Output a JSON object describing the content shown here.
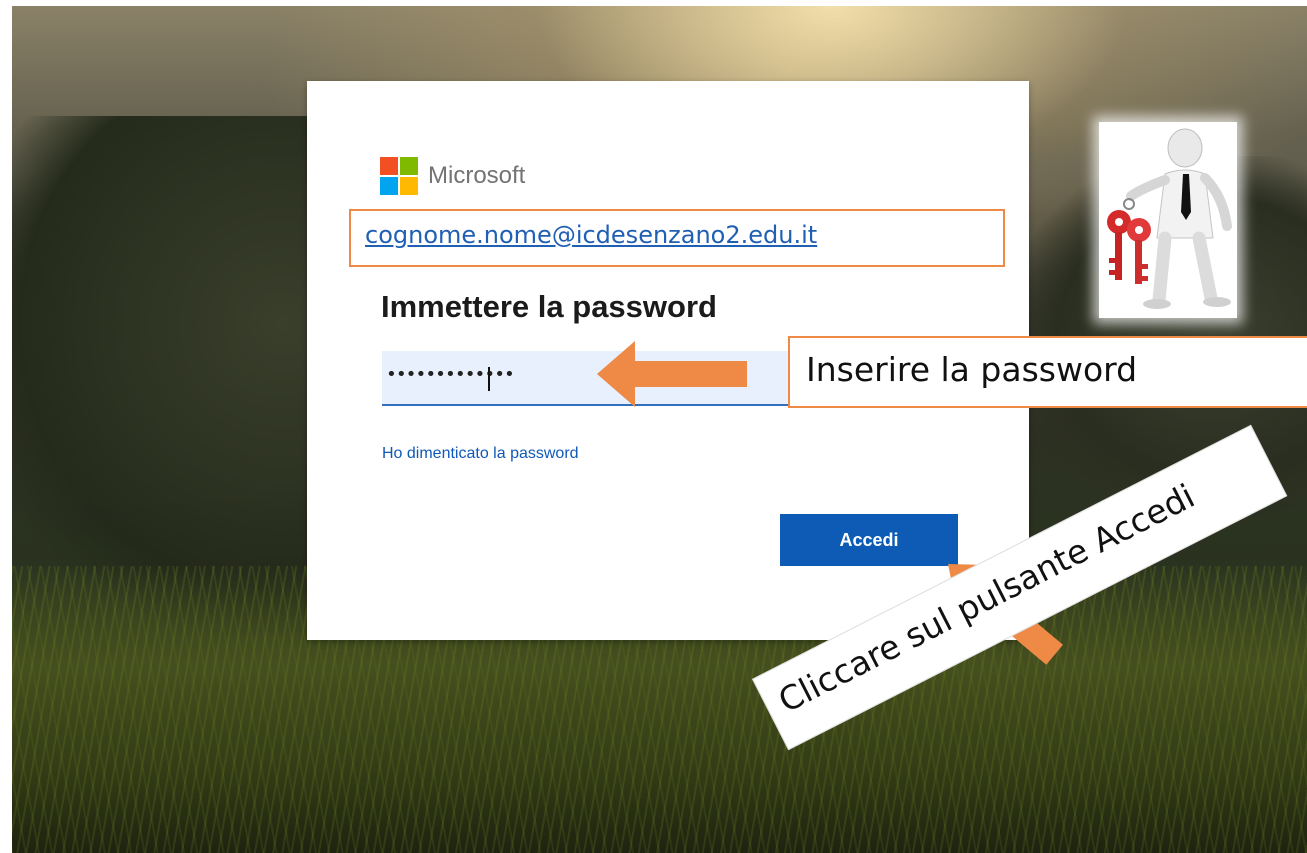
{
  "brand": {
    "name": "Microsoft",
    "logo_colors": [
      "#f25022",
      "#7fba00",
      "#00a4ef",
      "#ffb900"
    ]
  },
  "login": {
    "account_email": "cognome.nome@icdesenzano2.edu.it",
    "heading": "Immettere la password",
    "password_masked": "•••••••••••••",
    "forgot_password_label": "Ho dimenticato la password",
    "submit_label": "Accedi"
  },
  "annotations": {
    "password_hint": "Inserire la password",
    "submit_hint": "Cliccare sul pulsante Accedi",
    "arrow_color": "#ee8a46",
    "clipart": "businessman-with-red-keys-icon"
  },
  "colors": {
    "primary_button": "#0d5bb5",
    "link": "#1f5fb4",
    "highlight_border": "#ee8a46",
    "input_fill": "#e8f0fe"
  }
}
